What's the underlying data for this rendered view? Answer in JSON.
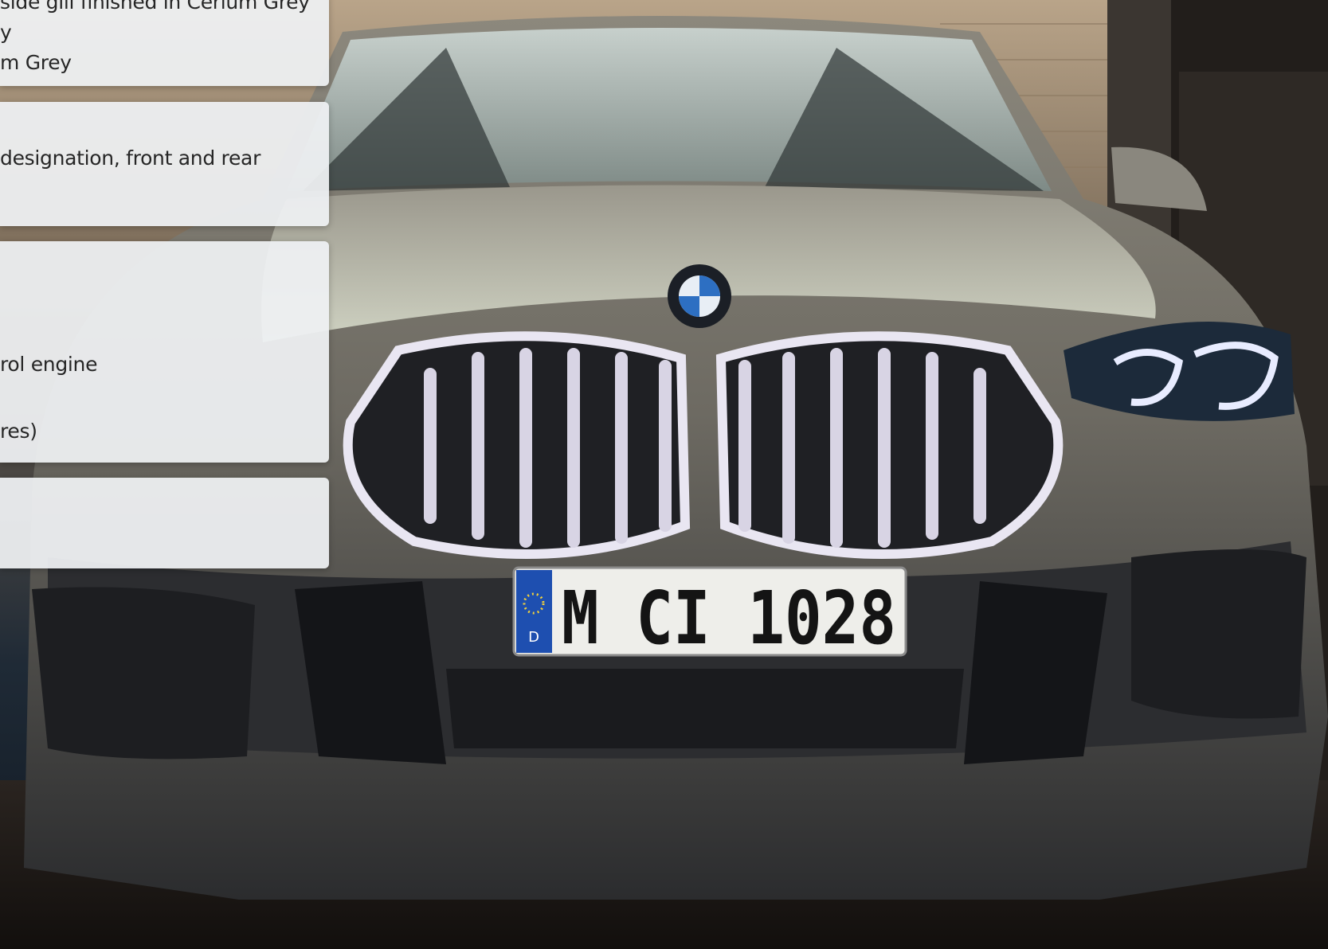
{
  "hero": {
    "subject": "car-front-image",
    "plate": {
      "country": "D",
      "text": "M CI 1028"
    },
    "colors": {
      "body": "#6d6a62",
      "grille_light": "#e9e6f2",
      "background": "#1b2530",
      "plate_blue": "#1e4fb0"
    }
  },
  "cards": [
    {
      "lines": [
        "side gill finished in Cerium Grey",
        "y",
        "m Grey"
      ]
    },
    {
      "lines": [
        "designation, front and rear"
      ]
    },
    {
      "lines": [
        "rol engine",
        "res)"
      ]
    },
    {
      "lines": []
    }
  ]
}
